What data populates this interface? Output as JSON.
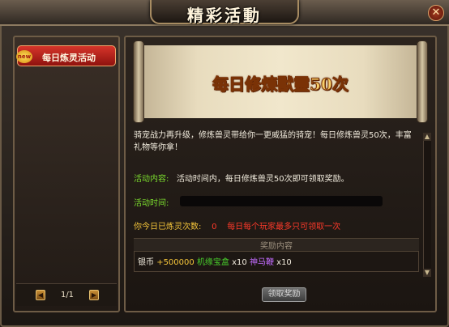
{
  "window": {
    "title": "精彩活動",
    "close_glyph": "✕"
  },
  "sidebar": {
    "badge": "new",
    "items": [
      {
        "label": "每日炼灵活动"
      }
    ],
    "pager": {
      "prev_glyph": "◀",
      "next_glyph": "▶",
      "page": "1/1"
    }
  },
  "event": {
    "banner_title": "每日修煉獸靈50次",
    "description": "骑宠战力再升级，修炼兽灵带给你一更威猛的骑宠！每日修炼兽灵50次，丰富礼物等你拿！",
    "content_label": "活动内容:",
    "content_text": "活动时间内，每日修炼兽灵50次即可领取奖励。",
    "time_label": "活动时间:",
    "count_label": "你今日已炼灵次数:",
    "count_value": "0",
    "limit_note": "每日每个玩家最多只可领取一次",
    "reward_header": "奖励内容",
    "rewards": {
      "silver_label": "银币",
      "silver_amount": "+500000",
      "item1_name": "机缘宝盒",
      "item1_qty": "x10",
      "item2_name": "神马鞭",
      "item2_qty": "x10"
    },
    "claim_button": "领取奖励"
  },
  "colors": {
    "accent_red": "#d6342a",
    "label_green": "#7bdc2e",
    "label_yellow": "#f4c53a",
    "value_red": "#ff3a2a",
    "item_purple": "#c26cff"
  }
}
